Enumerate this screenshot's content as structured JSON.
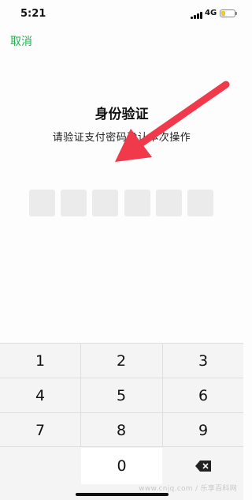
{
  "status_bar": {
    "time": "5:21",
    "network": "4G",
    "battery_level": 0.3,
    "battery_color": "#f3c531"
  },
  "nav": {
    "cancel_label": "取消",
    "accent": "#21b254"
  },
  "title": "身份验证",
  "subtitle": "请验证支付密码确认本次操作",
  "pin": {
    "length": 6,
    "entered": 0
  },
  "annotation": {
    "icon": "red-arrow-icon",
    "color": "#f0394a"
  },
  "keypad": {
    "keys": [
      "1",
      "2",
      "3",
      "4",
      "5",
      "6",
      "7",
      "8",
      "9",
      "0"
    ],
    "delete_icon": "backspace-icon"
  },
  "watermark": "www.cnjq.com / 乐享百科网"
}
